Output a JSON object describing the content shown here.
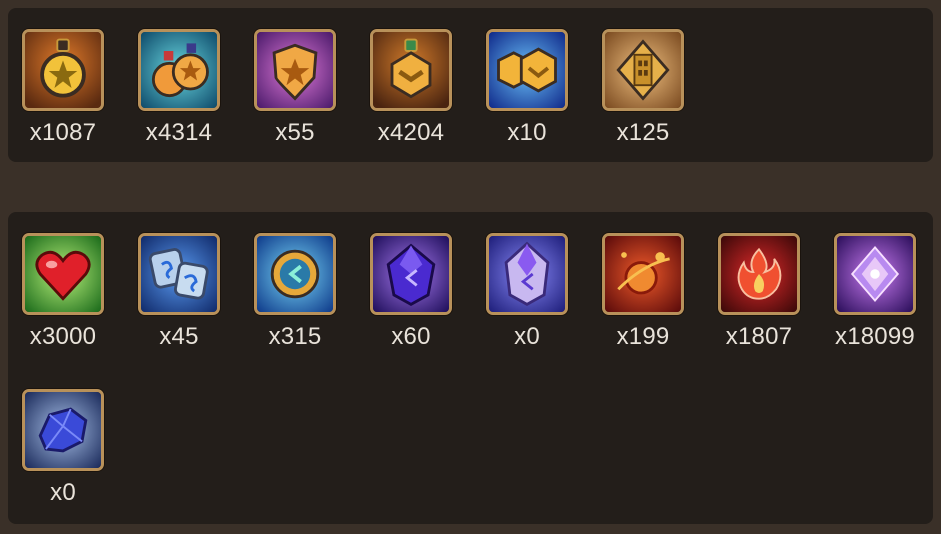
{
  "inventory": {
    "medals": [
      {
        "icon": "gold-star-medal-icon",
        "count": "x1087",
        "bg": "#8a4a1e",
        "accent": "#f2c23a"
      },
      {
        "icon": "double-star-medal-icon",
        "count": "x4314",
        "bg": "#1f8ea0",
        "accent": "#f09a3a"
      },
      {
        "icon": "purple-star-badge-icon",
        "count": "x55",
        "bg": "#8a2fa8",
        "accent": "#f0a845"
      },
      {
        "icon": "bronze-chevron-medal-icon",
        "count": "x4204",
        "bg": "#8a4e1c",
        "accent": "#f0b040"
      },
      {
        "icon": "blue-chevron-badges-icon",
        "count": "x10",
        "bg": "#1c56c8",
        "accent": "#f2b43a"
      },
      {
        "icon": "tower-badge-icon",
        "count": "x125",
        "bg": "#b87c3a",
        "accent": "#e6b04a"
      }
    ],
    "materials": [
      {
        "icon": "red-heart-icon",
        "count": "x3000",
        "bg": "#3fa52a",
        "accent": "#e0202a"
      },
      {
        "icon": "rune-stones-icon",
        "count": "x45",
        "bg": "#2a5ec8",
        "accent": "#b8d0ec"
      },
      {
        "icon": "gold-coin-arrow-icon",
        "count": "x315",
        "bg": "#1e78d2",
        "accent": "#e6a83a"
      },
      {
        "icon": "purple-crystal-icon",
        "count": "x60",
        "bg": "#5a2ab8",
        "accent": "#4a2ad0"
      },
      {
        "icon": "clear-crystal-icon",
        "count": "x0",
        "bg": "#3a4ad0",
        "accent": "#c8b8f0"
      },
      {
        "icon": "red-orb-icon",
        "count": "x199",
        "bg": "#a81a14",
        "accent": "#f08a30"
      },
      {
        "icon": "fire-flame-icon",
        "count": "x1807",
        "bg": "#8a1010",
        "accent": "#f05030"
      },
      {
        "icon": "violet-diamond-icon",
        "count": "x18099",
        "bg": "#5a2a9a",
        "accent": "#e8c8f8"
      },
      {
        "icon": "blue-ore-icon",
        "count": "x0",
        "bg": "#2a4a9a",
        "accent": "#3a4ad8"
      }
    ]
  }
}
